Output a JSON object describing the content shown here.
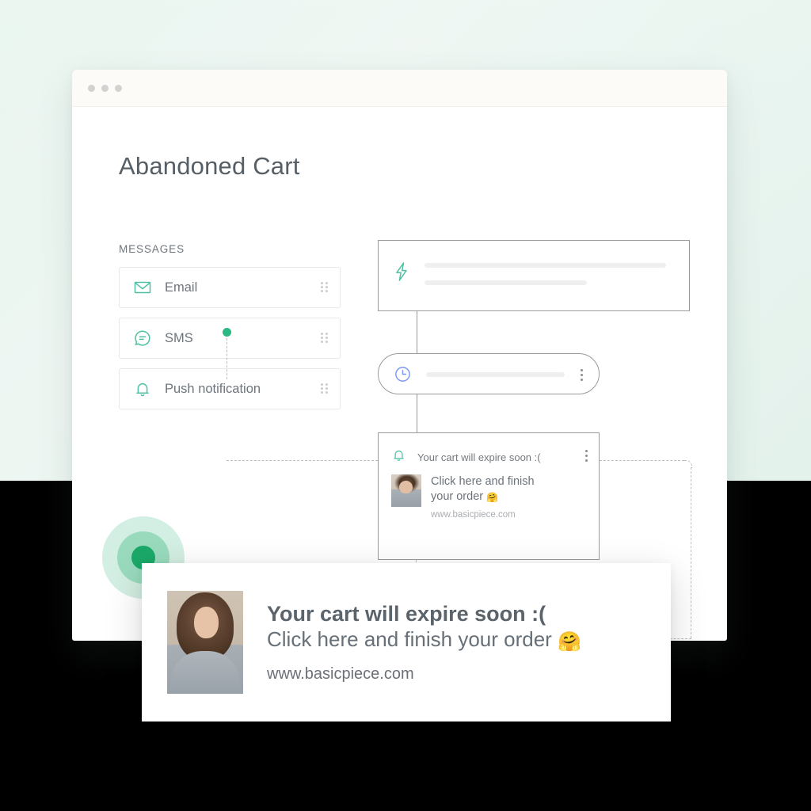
{
  "meta": {
    "accent_teal": "#2bb883",
    "accent_blue": "#7b97f0",
    "text_gray": "#6e757c",
    "border_gray": "#9a9a9a",
    "background_mint": "#e9f5ef",
    "titlebar_cream": "#fdfbf7"
  },
  "browser": {
    "traffic_lights": [
      "close-dot",
      "minimize-dot",
      "maximize-dot"
    ]
  },
  "page": {
    "title": "Abandoned Cart"
  },
  "sidebar": {
    "section_label": "MESSAGES",
    "items": [
      {
        "label": "Email",
        "icon": "envelope-icon"
      },
      {
        "label": "SMS",
        "icon": "chat-bubble-icon"
      },
      {
        "label": "Push notification",
        "icon": "bell-icon"
      }
    ],
    "drag_handle": "drag-handle-icon"
  },
  "flow": {
    "trigger_card": {
      "icon": "lightning-bolt-icon",
      "placeholder_lines": 2
    },
    "delay_card": {
      "icon": "clock-icon",
      "placeholder_lines": 1,
      "menu": "kebab-menu-icon"
    },
    "push_card": {
      "icon": "bell-icon",
      "title": "Your cart will expire soon :(",
      "body": "Click here and finish your order",
      "body_emoji": "🤗",
      "url": "www.basicpiece.com",
      "menu": "kebab-menu-icon",
      "thumbnail": "model-photo"
    },
    "connector_node": "green-connector-dot"
  },
  "overlay_notification": {
    "title": "Your cart will expire soon :(",
    "subtitle": "Click here and finish your order",
    "subtitle_emoji": "🤗",
    "url": "www.basicpiece.com",
    "thumbnail": "model-photo"
  },
  "decoration": {
    "rings": "concentric-circles-decoration"
  }
}
